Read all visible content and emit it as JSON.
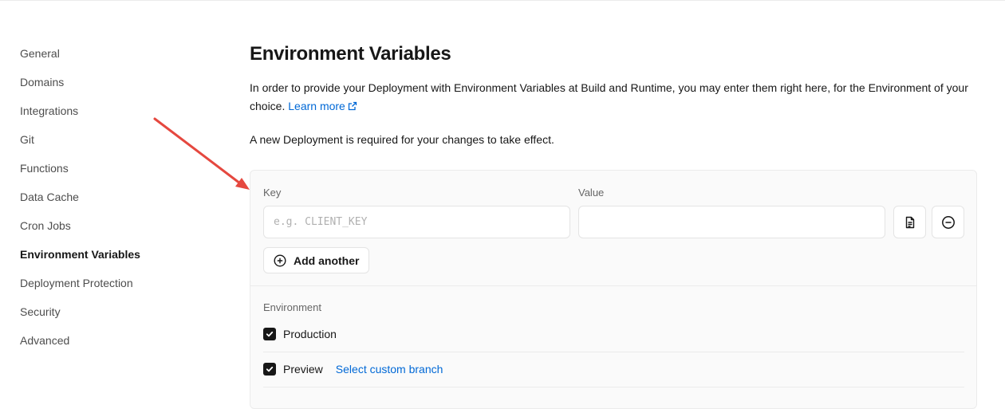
{
  "sidebar": {
    "items": [
      {
        "label": "General"
      },
      {
        "label": "Domains"
      },
      {
        "label": "Integrations"
      },
      {
        "label": "Git"
      },
      {
        "label": "Functions"
      },
      {
        "label": "Data Cache"
      },
      {
        "label": "Cron Jobs"
      },
      {
        "label": "Environment Variables",
        "active": true
      },
      {
        "label": "Deployment Protection"
      },
      {
        "label": "Security"
      },
      {
        "label": "Advanced"
      }
    ]
  },
  "main": {
    "title": "Environment Variables",
    "description": "In order to provide your Deployment with Environment Variables at Build and Runtime, you may enter them right here, for the Environment of your choice.",
    "learn_more": "Learn more",
    "note": "A new Deployment is required for your changes to take effect."
  },
  "form": {
    "key_label": "Key",
    "value_label": "Value",
    "key_placeholder": "e.g. CLIENT_KEY",
    "key_value": "",
    "value_value": "",
    "add_another": "Add another",
    "environment_label": "Environment",
    "environments": [
      {
        "label": "Production",
        "checked": true
      },
      {
        "label": "Preview",
        "checked": true,
        "link": "Select custom branch"
      }
    ]
  },
  "icons": {
    "external": "external-link-icon",
    "file": "file-text-icon",
    "remove": "minus-circle-icon",
    "add": "plus-circle-icon",
    "check": "check-icon"
  },
  "colors": {
    "link": "#0068d6",
    "annotation": "#e5483f",
    "checkbox": "#171717"
  }
}
